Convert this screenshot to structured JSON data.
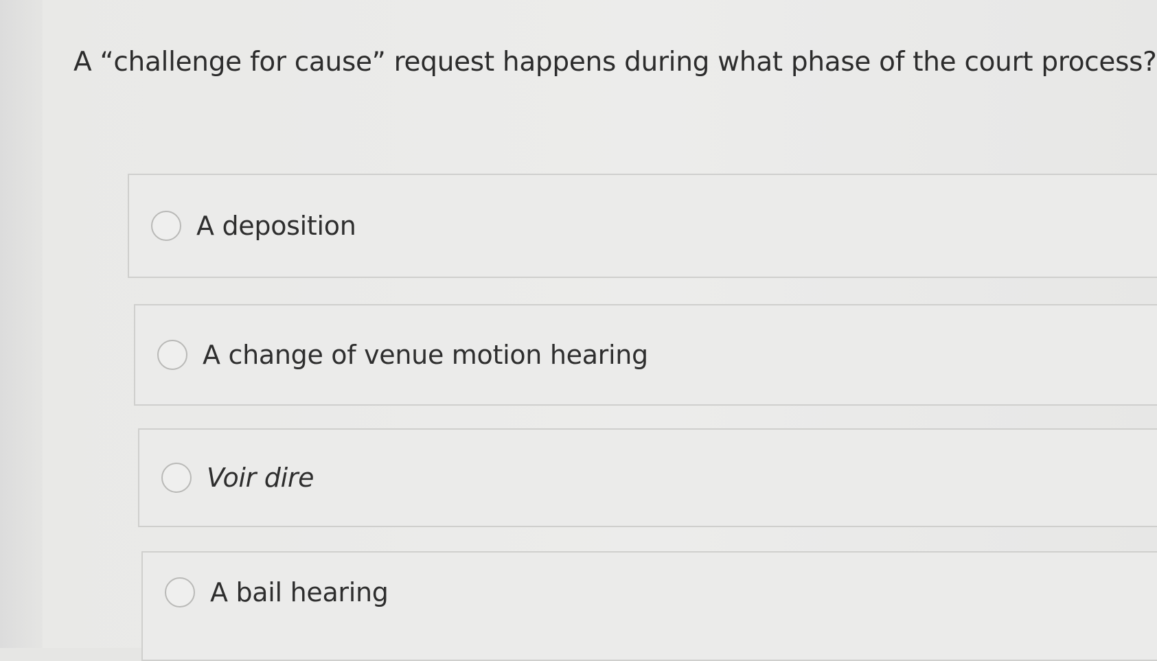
{
  "question": {
    "text": "A “challenge for cause” request happens during what phase of the court process?"
  },
  "choices": [
    {
      "label": "A deposition",
      "selected": false
    },
    {
      "label": "A change of venue motion hearing",
      "selected": false
    },
    {
      "label": "Voir dire",
      "selected": false
    },
    {
      "label": "A bail hearing",
      "selected": false
    }
  ]
}
